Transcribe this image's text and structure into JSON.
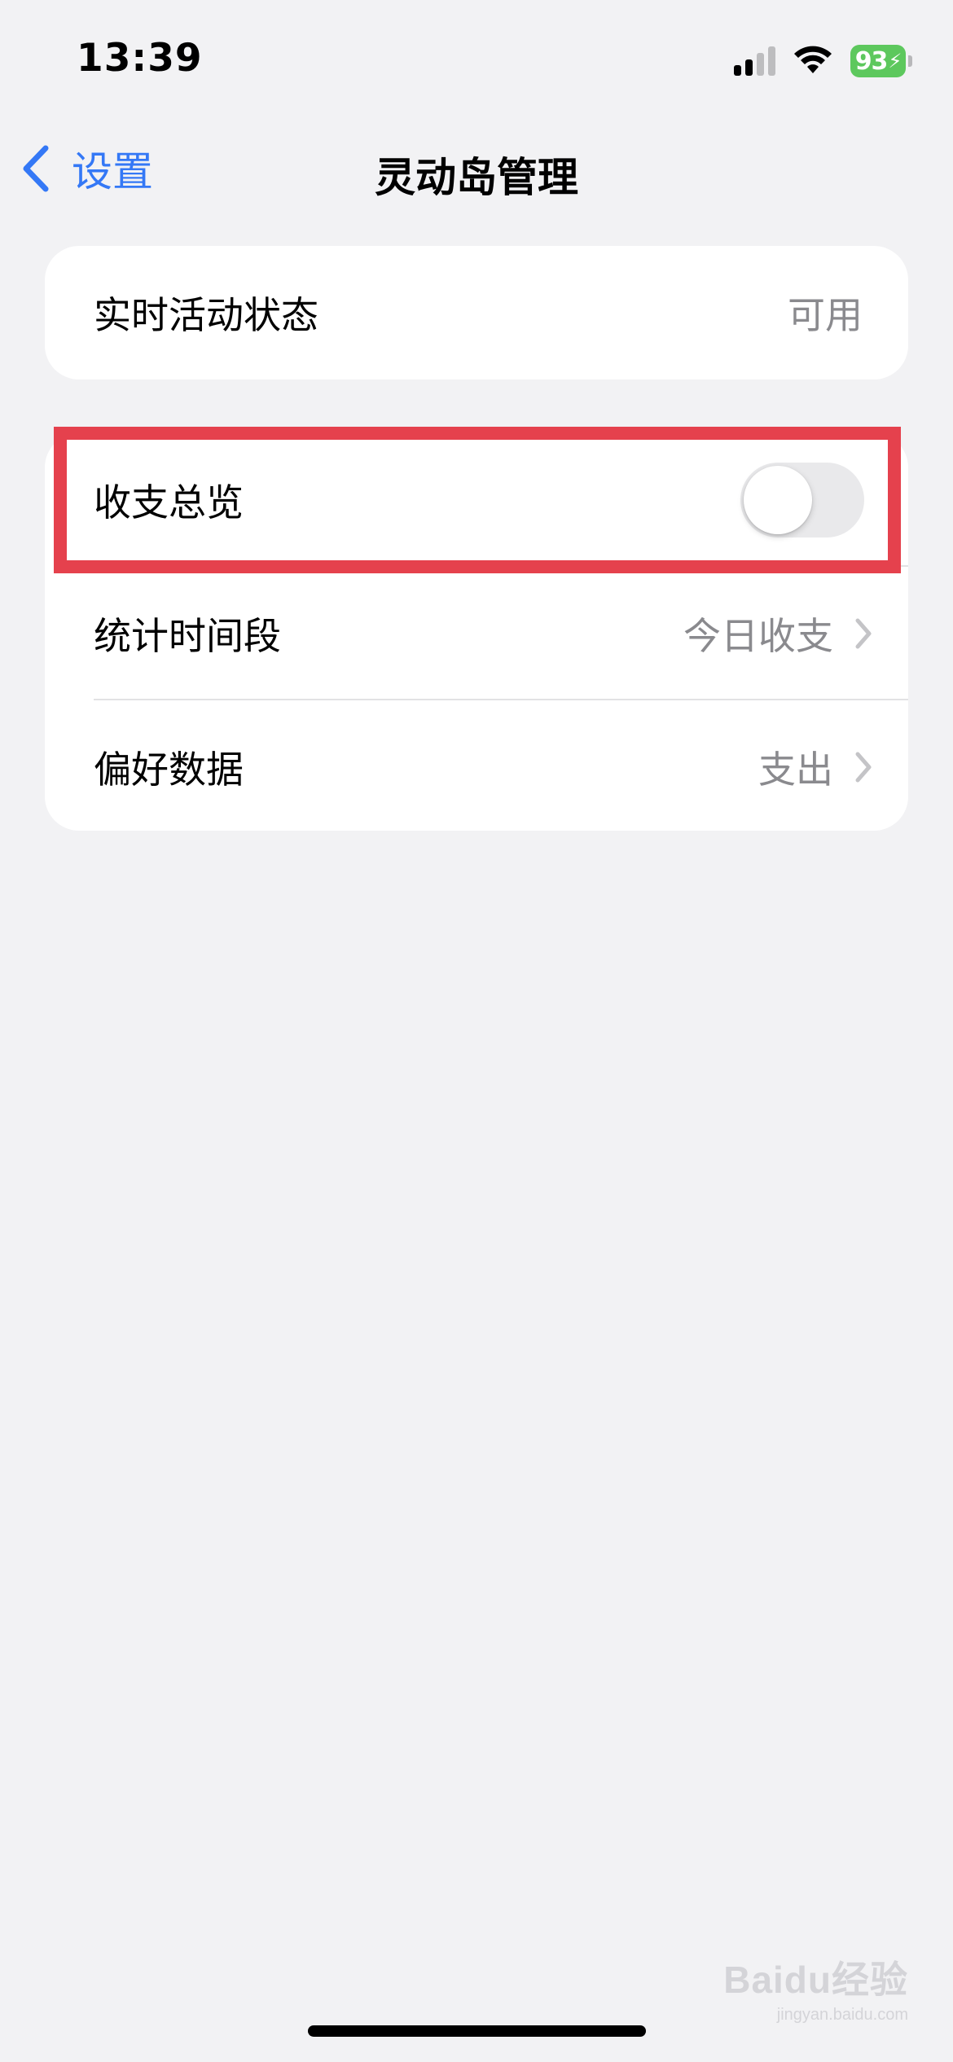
{
  "status_bar": {
    "time": "13:39",
    "battery_level": "93",
    "battery_bolt": "⚡",
    "signal_bars_active": 2,
    "signal_bars_total": 4
  },
  "nav": {
    "back_label": "设置",
    "title": "灵动岛管理"
  },
  "group1": {
    "live_activity": {
      "label": "实时活动状态",
      "value": "可用"
    }
  },
  "group2": {
    "overview": {
      "label": "收支总览",
      "toggle_on": false
    },
    "period": {
      "label": "统计时间段",
      "value": "今日收支"
    },
    "preference": {
      "label": "偏好数据",
      "value": "支出"
    }
  },
  "watermark": {
    "brand": "Baidu经验",
    "url": "jingyan.baidu.com"
  },
  "colors": {
    "accent": "#3478f6",
    "highlight": "#e5414d",
    "battery": "#5dc85d",
    "background": "#f2f2f4",
    "secondary_text": "#8a8a8e"
  }
}
